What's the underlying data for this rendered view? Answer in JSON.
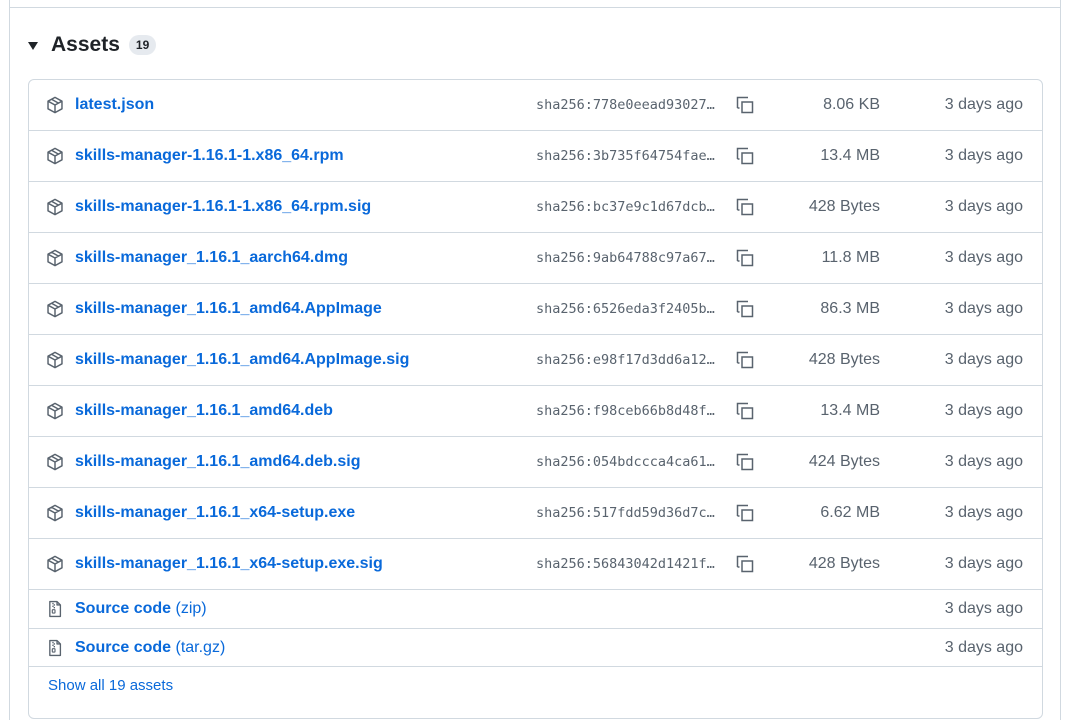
{
  "assets": {
    "title": "Assets",
    "count": "19",
    "files": [
      {
        "name": "latest.json",
        "sha": "sha256:778e0eead93027…",
        "size": "8.06 KB",
        "date": "3 days ago"
      },
      {
        "name": "skills-manager-1.16.1-1.x86_64.rpm",
        "sha": "sha256:3b735f64754fae…",
        "size": "13.4 MB",
        "date": "3 days ago"
      },
      {
        "name": "skills-manager-1.16.1-1.x86_64.rpm.sig",
        "sha": "sha256:bc37e9c1d67dcb…",
        "size": "428 Bytes",
        "date": "3 days ago"
      },
      {
        "name": "skills-manager_1.16.1_aarch64.dmg",
        "sha": "sha256:9ab64788c97a67…",
        "size": "11.8 MB",
        "date": "3 days ago"
      },
      {
        "name": "skills-manager_1.16.1_amd64.AppImage",
        "sha": "sha256:6526eda3f2405b…",
        "size": "86.3 MB",
        "date": "3 days ago"
      },
      {
        "name": "skills-manager_1.16.1_amd64.AppImage.sig",
        "sha": "sha256:e98f17d3dd6a12…",
        "size": "428 Bytes",
        "date": "3 days ago"
      },
      {
        "name": "skills-manager_1.16.1_amd64.deb",
        "sha": "sha256:f98ceb66b8d48f…",
        "size": "13.4 MB",
        "date": "3 days ago"
      },
      {
        "name": "skills-manager_1.16.1_amd64.deb.sig",
        "sha": "sha256:054bdccca4ca61…",
        "size": "424 Bytes",
        "date": "3 days ago"
      },
      {
        "name": "skills-manager_1.16.1_x64-setup.exe",
        "sha": "sha256:517fdd59d36d7c…",
        "size": "6.62 MB",
        "date": "3 days ago"
      },
      {
        "name": "skills-manager_1.16.1_x64-setup.exe.sig",
        "sha": "sha256:56843042d1421f…",
        "size": "428 Bytes",
        "date": "3 days ago"
      }
    ],
    "source": [
      {
        "name": "Source code",
        "suffix": "(zip)",
        "date": "3 days ago"
      },
      {
        "name": "Source code",
        "suffix": "(tar.gz)",
        "date": "3 days ago"
      }
    ],
    "show_all_label": "Show all 19 assets"
  },
  "icons": {
    "file_icon": "package-icon",
    "source_icon": "file-zip-icon",
    "copy_icon": "copy-icon",
    "caret_icon": "triangle-down-icon"
  },
  "colors": {
    "link": "#0969da",
    "muted": "#59636e",
    "border": "#d1d9e0"
  }
}
